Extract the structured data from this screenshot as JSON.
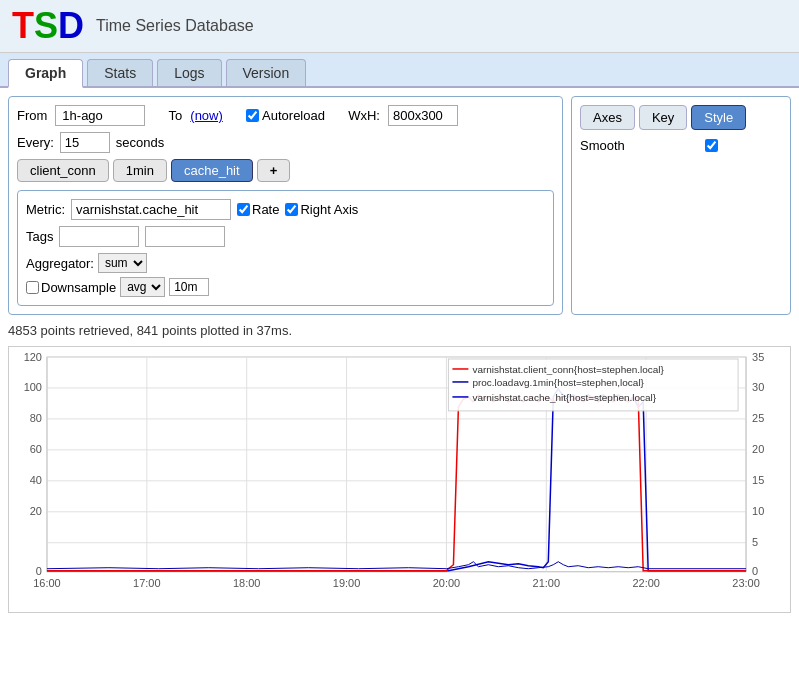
{
  "app": {
    "logo": "TSD",
    "logo_t": "T",
    "logo_s": "S",
    "logo_d": "D",
    "title": "Time Series Database"
  },
  "nav": {
    "tabs": [
      {
        "label": "Graph",
        "active": true
      },
      {
        "label": "Stats",
        "active": false
      },
      {
        "label": "Logs",
        "active": false
      },
      {
        "label": "Version",
        "active": false
      }
    ]
  },
  "controls": {
    "from_label": "From",
    "from_value": "1h-ago",
    "to_label": "To",
    "to_now": "(now)",
    "autoreload_label": "Autoreload",
    "autoreload_checked": true,
    "every_label": "Every:",
    "every_value": "15",
    "seconds_label": "seconds",
    "wxh_label": "WxH:",
    "wxh_value": "800x300",
    "axes_btn": "Axes",
    "key_btn": "Key",
    "style_btn": "Style",
    "smooth_label": "Smooth",
    "smooth_checked": true
  },
  "pills": [
    {
      "label": "client_conn",
      "active": false
    },
    {
      "label": "1min",
      "active": false
    },
    {
      "label": "cache_hit",
      "active": true
    },
    {
      "label": "+",
      "active": false,
      "is_add": true
    }
  ],
  "metric": {
    "label": "Metric:",
    "value": "varnishstat.cache_hit",
    "rate_label": "Rate",
    "rate_checked": true,
    "right_axis_label": "Right Axis",
    "right_axis_checked": true,
    "aggregator_label": "Aggregator:",
    "aggregator_value": "sum",
    "downsample_label": "Downsample",
    "downsample_checked": false,
    "downsample_fn": "avg",
    "downsample_interval": "10m",
    "tags_label": "Tags"
  },
  "status": {
    "text": "4853 points retrieved, 841 points plotted in 37ms."
  },
  "chart": {
    "y_left_labels": [
      "120",
      "100",
      "80",
      "60",
      "40",
      "20",
      "0"
    ],
    "y_right_labels": [
      "35",
      "30",
      "25",
      "20",
      "15",
      "10",
      "5",
      "0"
    ],
    "x_labels": [
      "16:00",
      "17:00",
      "18:00",
      "19:00",
      "20:00",
      "21:00",
      "22:00",
      "23:00"
    ],
    "legend": [
      {
        "label": "varnishstat.client_conn{host=stephen.local}",
        "color": "#e00"
      },
      {
        "label": "proc.loadavg.1min{host=stephen,local}",
        "color": "#00a"
      },
      {
        "label": "varnishstat.cache_hit{host=stephen.local}",
        "color": "#00c"
      }
    ]
  }
}
